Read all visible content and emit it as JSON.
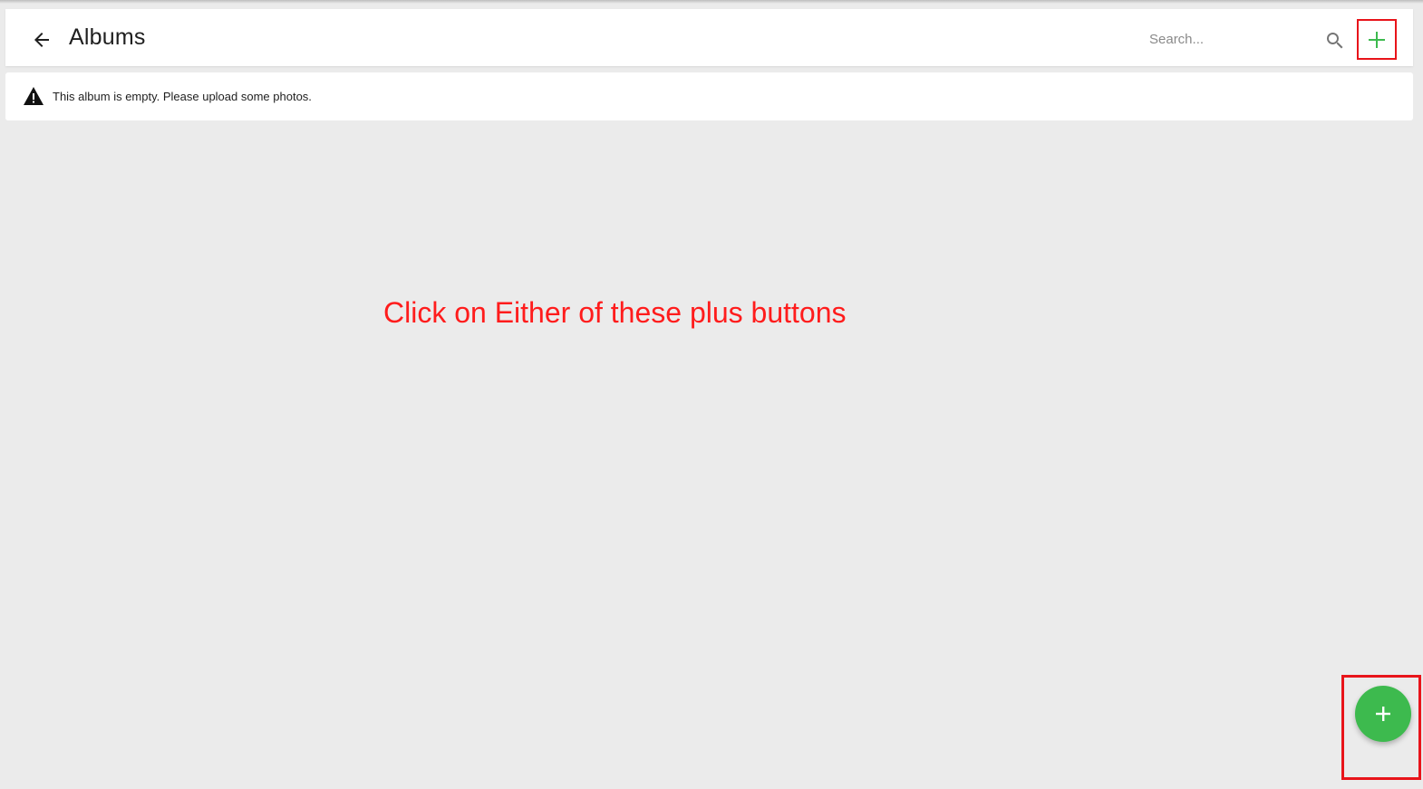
{
  "header": {
    "title": "Albums",
    "search": {
      "placeholder": "Search...",
      "value": ""
    },
    "back_icon": "arrow-left-icon",
    "search_icon": "search-icon",
    "add_icon": "plus-icon"
  },
  "notice": {
    "icon": "warning-icon",
    "text": "This album is empty. Please upload some photos."
  },
  "annotation": {
    "text": "Click on Either of these plus buttons",
    "color": "#ff1c1c",
    "highlight_color": "#e8141a"
  },
  "fab": {
    "icon": "plus-icon",
    "color": "#3dba4e"
  },
  "colors": {
    "background": "#ebebeb",
    "surface": "#ffffff",
    "accent": "#3dba4e"
  }
}
